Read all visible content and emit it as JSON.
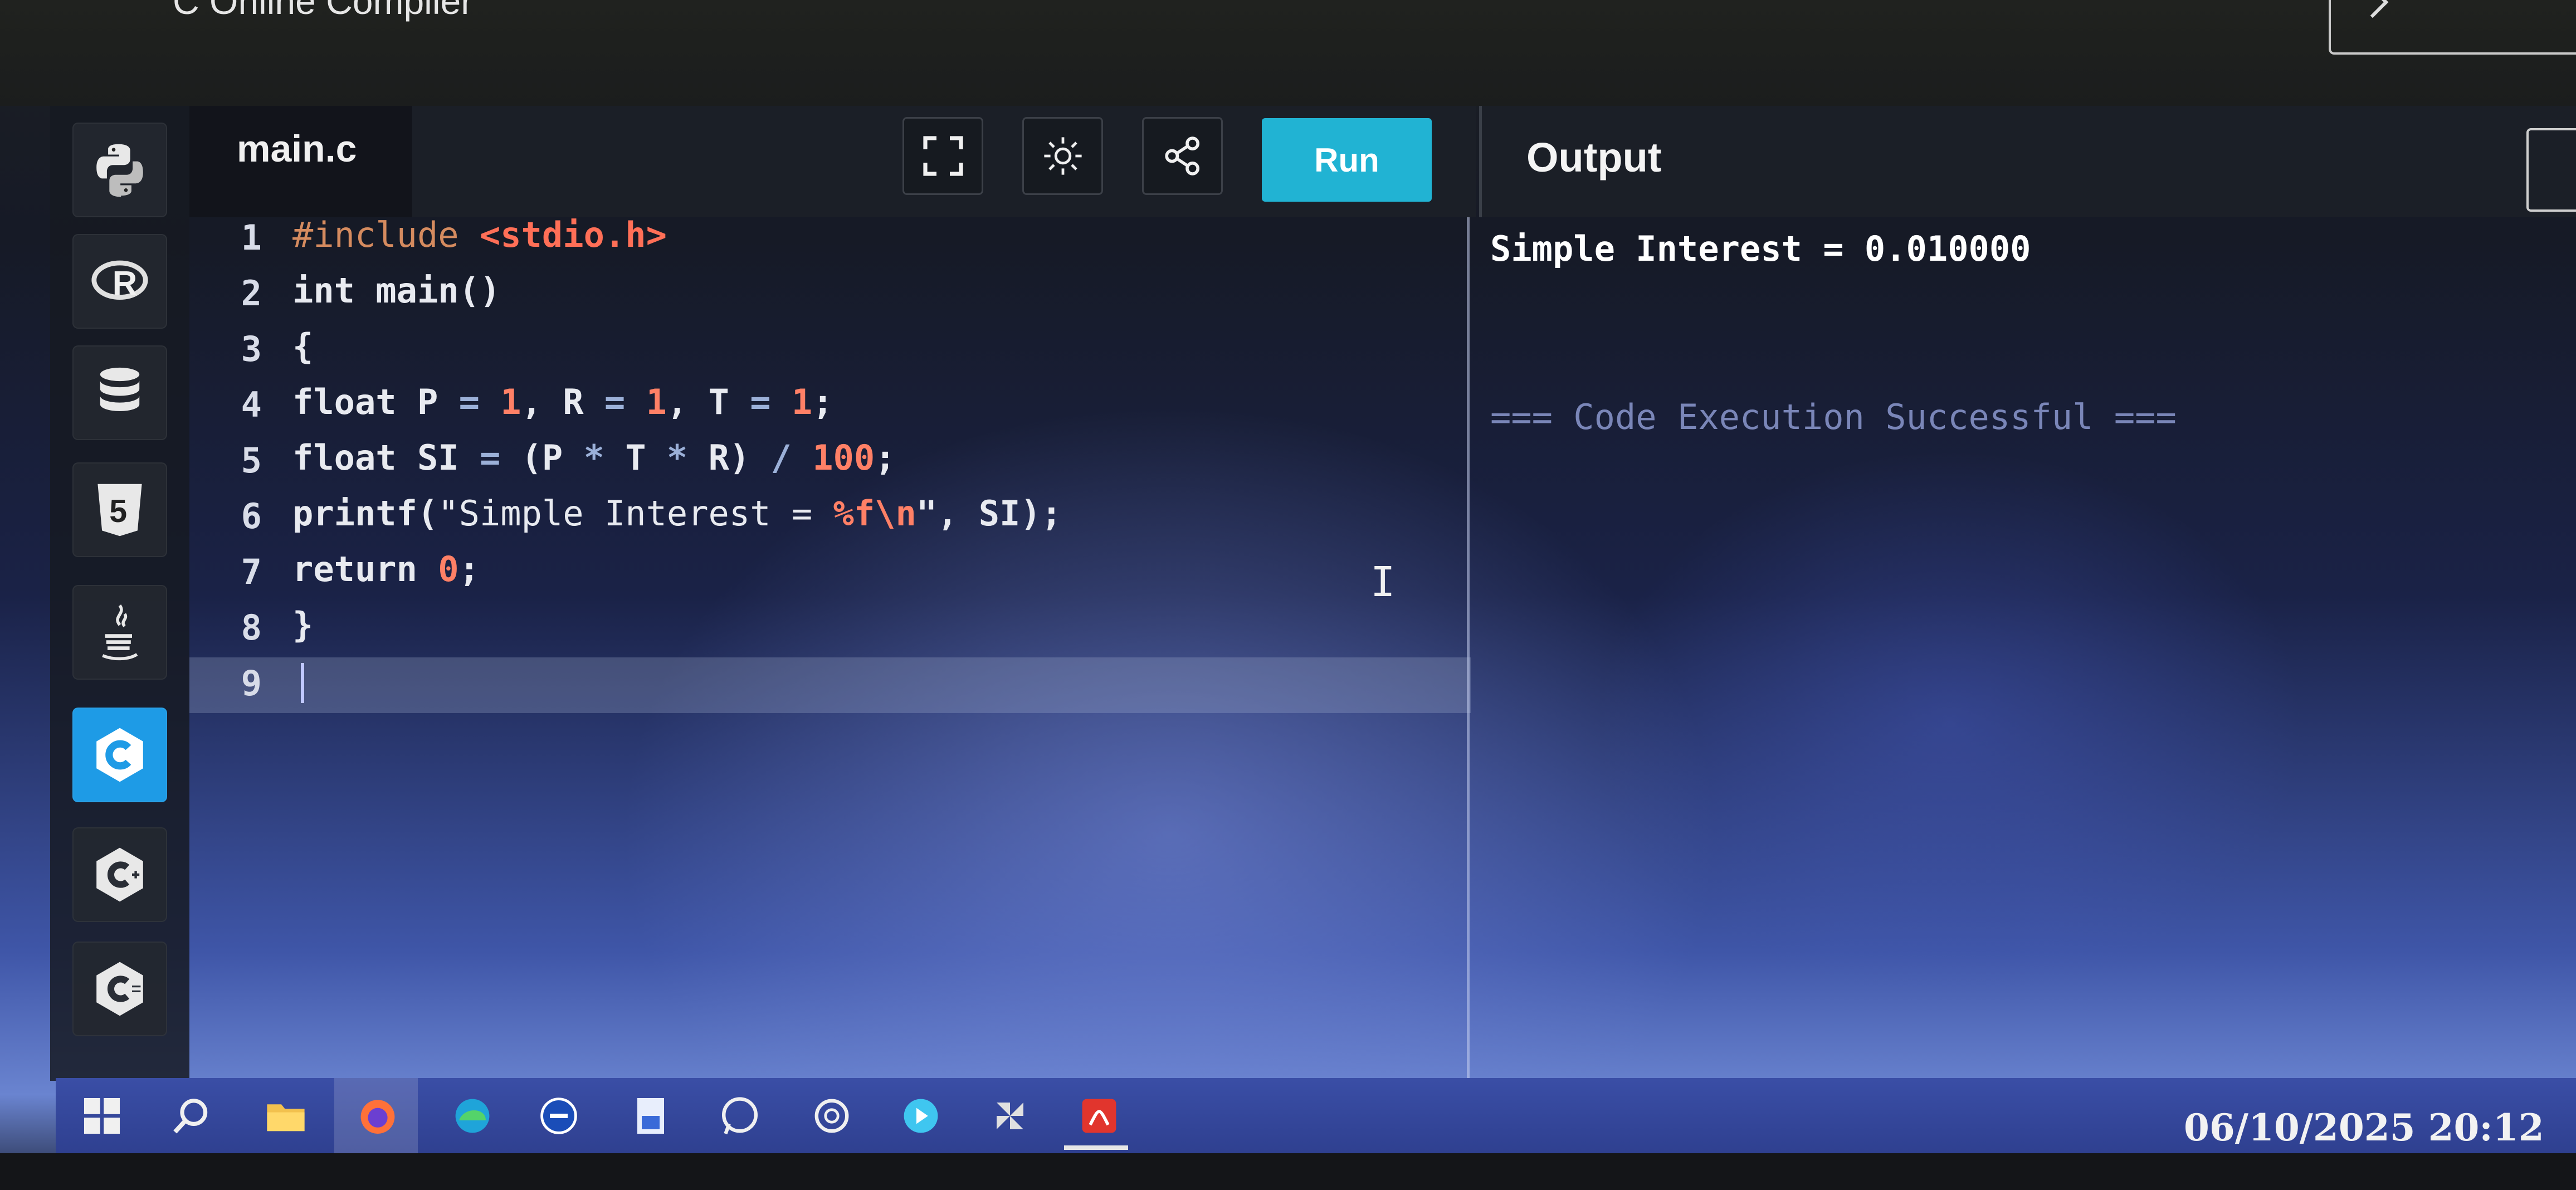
{
  "browser": {
    "site_title": "C Online Compiler"
  },
  "languages": [
    {
      "name": "python-icon"
    },
    {
      "name": "r-icon"
    },
    {
      "name": "database-icon"
    },
    {
      "name": "html5-icon"
    },
    {
      "name": "java-icon"
    },
    {
      "name": "c-icon",
      "active": true
    },
    {
      "name": "cpp-icon"
    },
    {
      "name": "csharp-icon"
    }
  ],
  "editor": {
    "file_tab": "main.c",
    "run_label": "Run",
    "line_numbers": [
      "1",
      "2",
      "3",
      "4",
      "5",
      "6",
      "7",
      "8",
      "9"
    ],
    "code": {
      "l1_pp": "#include ",
      "l1_hdr": "<stdio.h>",
      "l2": "int main()",
      "l3": "{",
      "l4_a": "float P ",
      "l4_b": "= ",
      "l4_c": "1",
      "l4_d": ", R ",
      "l4_e": "= ",
      "l4_f": "1",
      "l4_g": ", T ",
      "l4_h": "= ",
      "l4_i": "1",
      "l4_j": ";",
      "l5_a": "float SI ",
      "l5_b": "= ",
      "l5_c": "(P ",
      "l5_d": "* ",
      "l5_e": "T ",
      "l5_f": "* ",
      "l5_g": "R) ",
      "l5_h": "/ ",
      "l5_i": "100",
      "l5_j": ";",
      "l6_a": "printf(",
      "l6_b": "\"Simple Interest = ",
      "l6_c": "%f\\n",
      "l6_d": "\"",
      "l6_e": ", SI);",
      "l7_a": "return ",
      "l7_b": "0",
      "l7_c": ";",
      "l8": "}",
      "l9": ""
    }
  },
  "output": {
    "title": "Output",
    "result": "Simple Interest = 0.010000",
    "status": "=== Code Execution Successful ==="
  },
  "taskbar": {
    "clock": "06/10/2025 20:12"
  },
  "colors": {
    "run_button": "#21b3d3",
    "active_language": "#1e9be6",
    "string": "#ff6f57",
    "number": "#ff8066"
  }
}
